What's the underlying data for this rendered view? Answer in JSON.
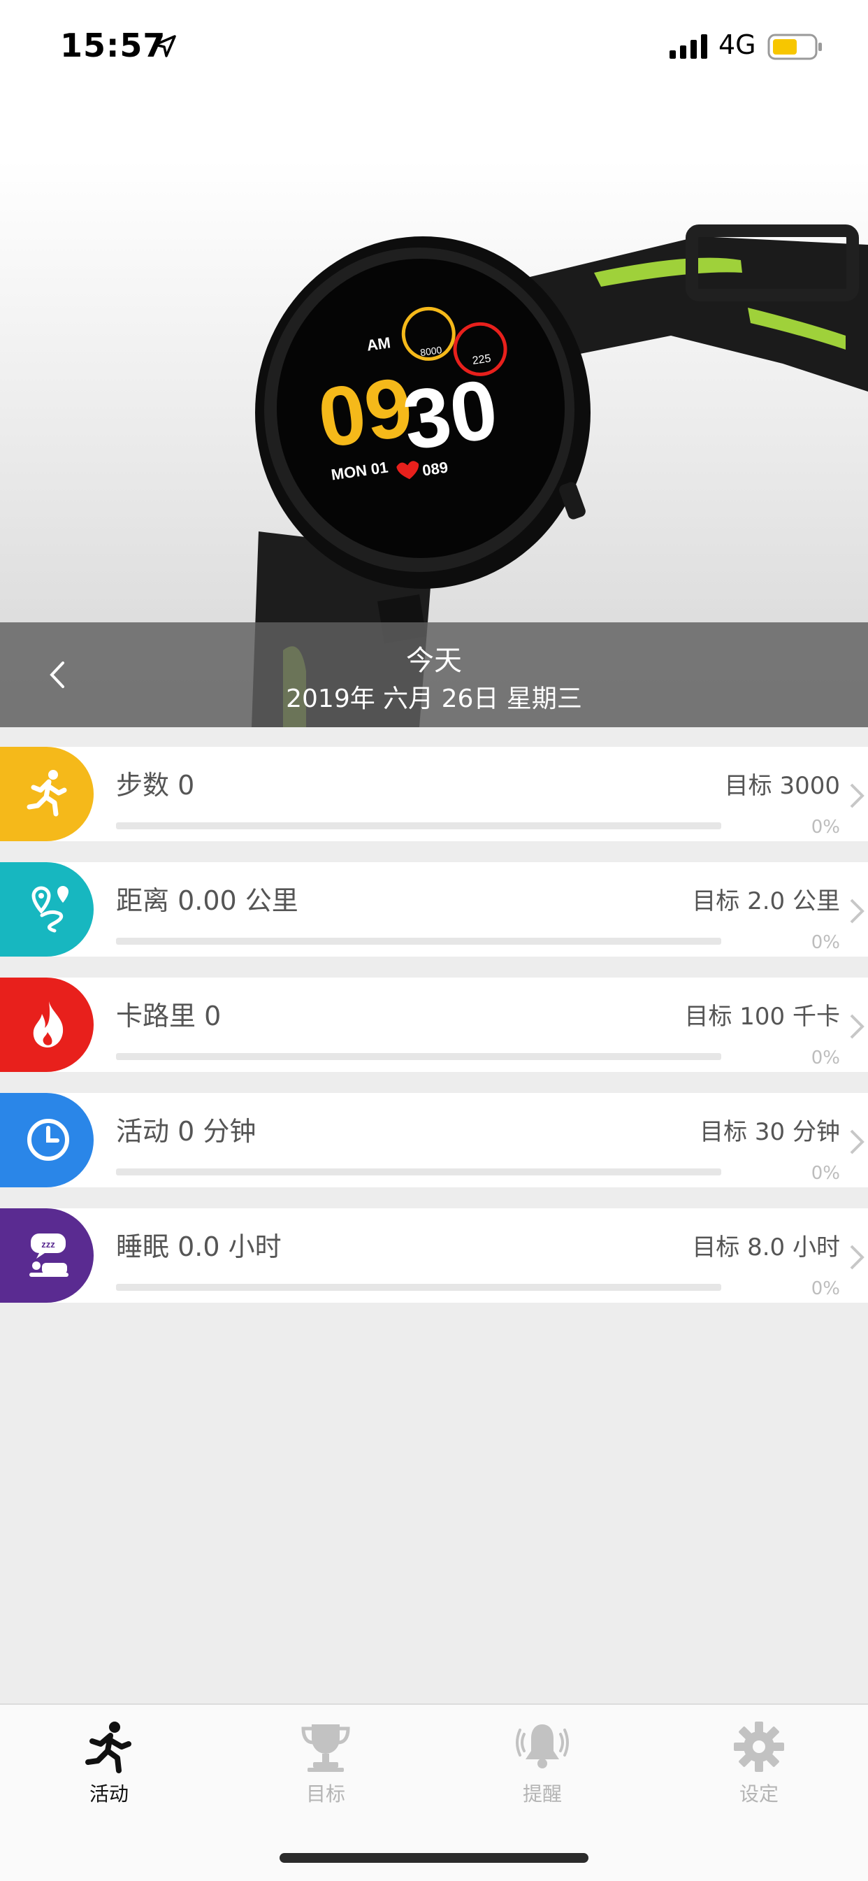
{
  "status_bar": {
    "time": "15:57",
    "network": "4G",
    "battery_color": "#f7c600"
  },
  "hero": {
    "watch_face": {
      "hour": "09",
      "minute": "30",
      "am": "AM",
      "steps": "8000",
      "calories": "225",
      "date_line": "MON 01",
      "heart_rate": "089"
    },
    "title": "今天",
    "date": "2019年 六月 26日 星期三"
  },
  "metrics": [
    {
      "id": "steps",
      "title": "步数 0",
      "goal": "目标 3000",
      "percent_label": "0%",
      "percent": 0,
      "color": "#f5b91a",
      "icon": "running-icon"
    },
    {
      "id": "distance",
      "title": "距离 0.00 公里",
      "goal": "目标 2.0 公里",
      "percent_label": "0%",
      "percent": 0,
      "color": "#17b7c0",
      "icon": "route-pin-icon"
    },
    {
      "id": "calories",
      "title": "卡路里 0",
      "goal": "目标 100 千卡",
      "percent_label": "0%",
      "percent": 0,
      "color": "#e8201c",
      "icon": "flame-icon"
    },
    {
      "id": "activity",
      "title": "活动 0 分钟",
      "goal": "目标 30 分钟",
      "percent_label": "0%",
      "percent": 0,
      "color": "#2a86e8",
      "icon": "clock-icon"
    },
    {
      "id": "sleep",
      "title": "睡眠 0.0 小时",
      "goal": "目标 8.0 小时",
      "percent_label": "0%",
      "percent": 0,
      "color": "#5a2b91",
      "icon": "sleep-icon"
    }
  ],
  "tabs": [
    {
      "label": "活动",
      "icon": "running-icon",
      "active": true
    },
    {
      "label": "目标",
      "icon": "trophy-icon",
      "active": false
    },
    {
      "label": "提醒",
      "icon": "bell-icon",
      "active": false
    },
    {
      "label": "设定",
      "icon": "gear-icon",
      "active": false
    }
  ]
}
